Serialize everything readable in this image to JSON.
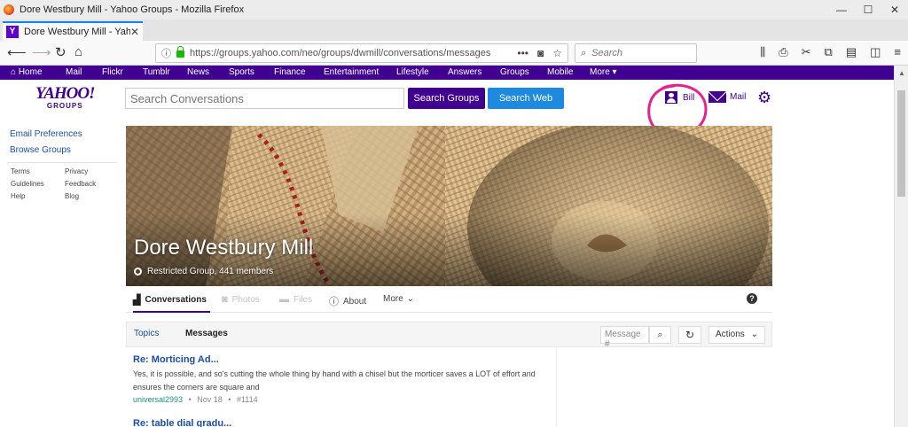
{
  "window": {
    "title": "Dore Westbury Mill - Yahoo Groups - Mozilla Firefox",
    "controls": [
      "—",
      "☐",
      "✕"
    ]
  },
  "browser": {
    "tab_title": "Dore Westbury Mill - Yahoo Gr",
    "tab_favicon": "Y",
    "url": "https://groups.yahoo.com/neo/groups/dwmill/conversations/messages",
    "search_placeholder": "Search"
  },
  "yahoo_nav": [
    "Home",
    "Mail",
    "Flickr",
    "Tumblr",
    "News",
    "Sports",
    "Finance",
    "Entertainment",
    "Lifestyle",
    "Answers",
    "Groups",
    "Mobile",
    "More ▾"
  ],
  "header": {
    "logo_main": "YAHOO!",
    "logo_sub": "GROUPS",
    "search_placeholder": "Search Conversations",
    "search_groups_label": "Search Groups",
    "search_web_label": "Search Web",
    "user_name": "Bill",
    "mail_label": "Mail",
    "annotation_color": "#e5238f"
  },
  "sidebar": {
    "email_prefs": "Email Preferences",
    "browse_groups": "Browse Groups",
    "links_left": [
      "Terms",
      "Guidelines",
      "Help"
    ],
    "links_right": [
      "Privacy",
      "Feedback",
      "Blog"
    ]
  },
  "group": {
    "name": "Dore Westbury Mill",
    "info": "Restricted Group, 441 members"
  },
  "group_tabs": {
    "conversations": "Conversations",
    "photos": "Photos",
    "files": "Files",
    "about": "About",
    "more": "More"
  },
  "subbar": {
    "topics": "Topics",
    "messages": "Messages",
    "msg_placeholder": "Message #",
    "actions": "Actions"
  },
  "messages": [
    {
      "subject": "Re: Morticing Ad...",
      "body": "Yes, it is possible, and so's cutting the whole thing by hand with a chisel but the morticer saves a LOT of effort and ensures the corners are square and",
      "author": "universal2993",
      "date": "Nov 18",
      "number": "#1114"
    },
    {
      "subject": "Re: table dial gradu...",
      "body": "",
      "author": "",
      "date": "",
      "number": ""
    }
  ],
  "colors": {
    "yahoo_purple": "#400090",
    "link_blue": "#1a4dab",
    "search_web_blue": "#1d8ae0"
  }
}
